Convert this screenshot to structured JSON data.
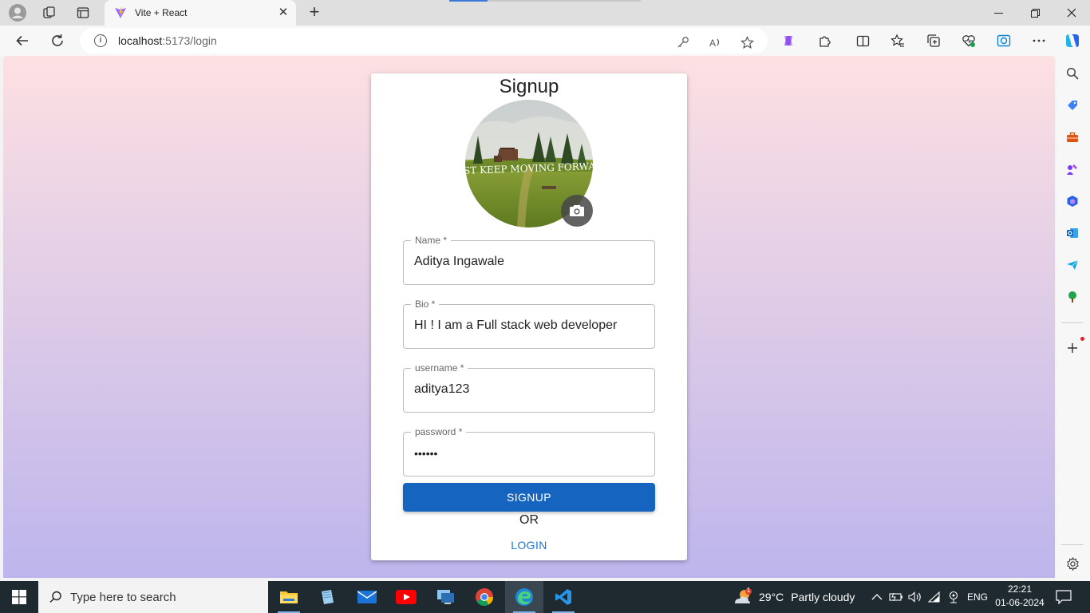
{
  "browser": {
    "tab_title": "Vite + React",
    "url_host": "localhost",
    "url_path": ":5173/login"
  },
  "page": {
    "card_title": "Signup",
    "avatar_caption": "UST KEEP MOVING FORWAR",
    "fields": [
      {
        "label": "Name *",
        "value": "Aditya Ingawale"
      },
      {
        "label": "Bio *",
        "value": "HI ! I am a Full stack web developer"
      },
      {
        "label": "username *",
        "value": "aditya123"
      },
      {
        "label": "password *",
        "value": "••••••"
      }
    ],
    "signup_label": "SIGNUP",
    "or_text": "OR",
    "login_label": "LOGIN"
  },
  "taskbar": {
    "search_placeholder": "Type here to search",
    "weather_temp": "29°C",
    "weather_text": "Partly cloudy",
    "language": "ENG",
    "time": "22:21",
    "date": "01-06-2024",
    "weather_badge": "1"
  },
  "colors": {
    "accent": "#1565c0",
    "link": "#1976d2",
    "gradient_top": "#fde0e2",
    "gradient_bottom": "#bdb5ec"
  },
  "icons": [
    "profile-icon",
    "workspaces-icon",
    "tab-actions-icon",
    "vite-favicon",
    "close-icon",
    "new-tab-icon",
    "minimize-icon",
    "restore-icon",
    "window-close-icon",
    "back-icon",
    "refresh-icon",
    "info-icon",
    "key-icon",
    "read-aloud-icon",
    "favorite-star-icon",
    "copilot-icon",
    "extensions-icon",
    "split-screen-icon",
    "favorites-icon",
    "collections-icon",
    "performance-icon",
    "browser-essentials-icon",
    "more-icon",
    "camera-icon",
    "windows-start-icon",
    "search-icon"
  ]
}
